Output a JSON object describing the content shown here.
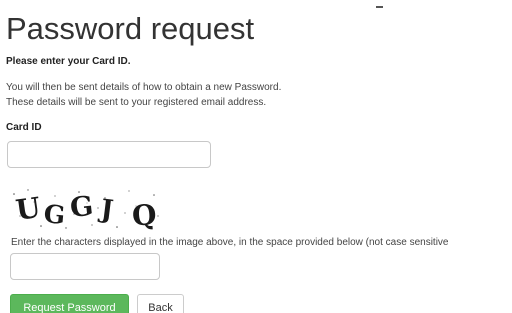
{
  "page": {
    "title": "Password request",
    "instruction": "Please enter your Card ID.",
    "info_line_1": "You will then be sent details of how to obtain a new Password.",
    "info_line_2": "These details will be sent to your registered email address."
  },
  "card_field": {
    "label": "Card ID",
    "value": "",
    "placeholder": ""
  },
  "captcha": {
    "characters": [
      "U",
      "G",
      "G",
      "J",
      "Q"
    ],
    "prompt": "Enter the characters displayed in the image above, in the space provided below (not case sensitive",
    "input_value": "",
    "input_placeholder": ""
  },
  "buttons": {
    "request_label": "Request Password",
    "back_label": "Back"
  },
  "colors": {
    "primary_button": "#5cb85c",
    "text": "#333333",
    "captcha_ink": "#1a1a1a"
  }
}
